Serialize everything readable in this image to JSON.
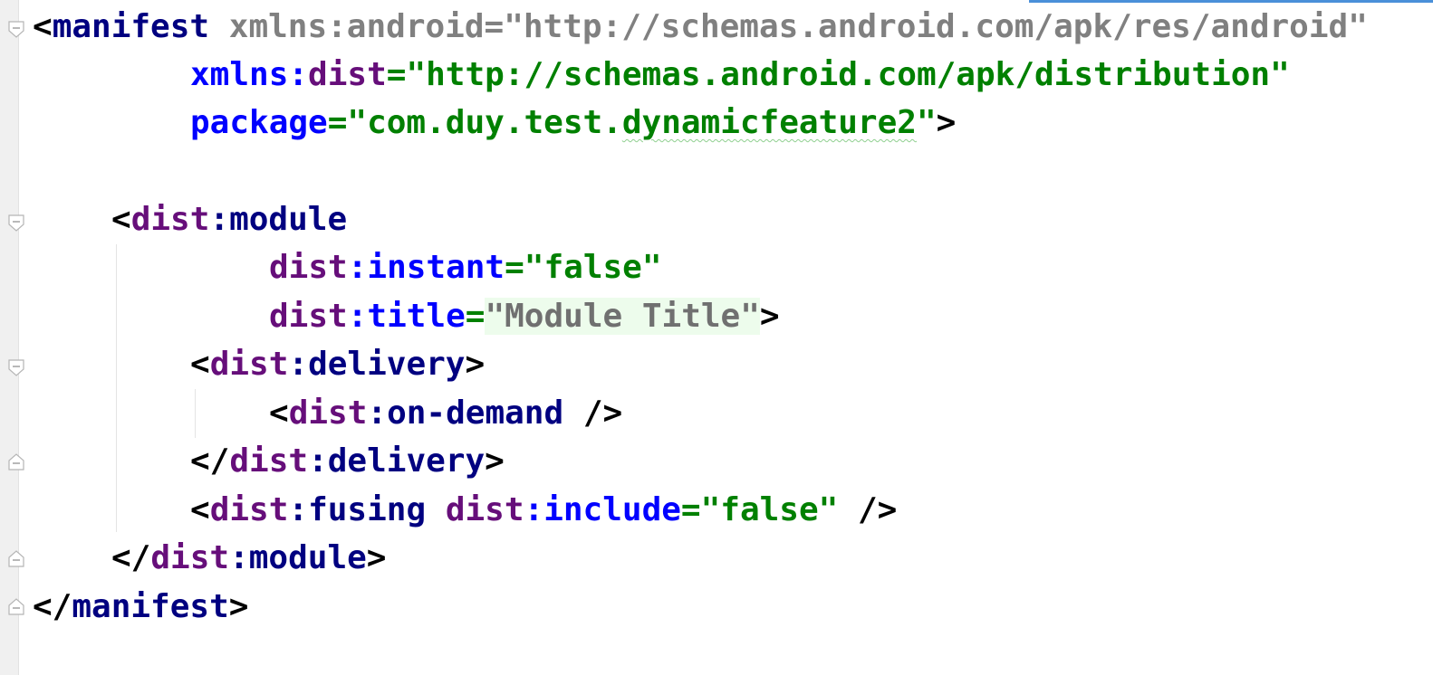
{
  "editor": {
    "language": "xml",
    "accent_color": "#4a90d9",
    "colors": {
      "tag": "#000080",
      "namespace": "#660e7a",
      "attribute": "#0000ff",
      "value": "#008000",
      "unused": "#808080",
      "highlight": "#edfcec"
    }
  },
  "code": {
    "manifest_open": {
      "lt": "<",
      "tag": "manifest",
      "sp": " ",
      "attr": "xmlns:android",
      "eq": "=",
      "value": "\"http://schemas.android.com/apk/res/android\""
    },
    "xmlns_dist": {
      "prefix": "xmlns:",
      "name": "dist",
      "eq": "=",
      "value": "\"http://schemas.android.com/apk/distribution\""
    },
    "package": {
      "attr": "package",
      "eq": "=",
      "value_start": "\"com.duy.test.",
      "value_squiggly": "dynamicfeature2",
      "value_end": "\"",
      "gt": ">"
    },
    "module_open": {
      "lt": "<",
      "ns": "dist",
      "colon": ":",
      "tag": "module"
    },
    "instant": {
      "ns": "dist",
      "colon": ":",
      "attr": "instant",
      "eq": "=",
      "value": "\"false\""
    },
    "title": {
      "ns": "dist",
      "colon": ":",
      "attr": "title",
      "eq": "=",
      "value": "\"Module Title\"",
      "gt": ">"
    },
    "delivery_open": {
      "lt": "<",
      "ns": "dist",
      "colon": ":",
      "tag": "delivery",
      "gt": ">"
    },
    "on_demand": {
      "lt": "<",
      "ns": "dist",
      "colon": ":",
      "tag": "on-demand",
      "end": " />"
    },
    "delivery_close": {
      "lt": "</",
      "ns": "dist",
      "colon": ":",
      "tag": "delivery",
      "gt": ">"
    },
    "fusing": {
      "lt": "<",
      "ns": "dist",
      "colon": ":",
      "tag": "fusing",
      "sp": " ",
      "attr_ns": "dist",
      "attr_colon": ":",
      "attr": "include",
      "eq": "=",
      "value": "\"false\"",
      "end": " />"
    },
    "module_close": {
      "lt": "</",
      "ns": "dist",
      "colon": ":",
      "tag": "module",
      "gt": ">"
    },
    "manifest_close": {
      "lt": "</",
      "tag": "manifest",
      "gt": ">"
    }
  }
}
